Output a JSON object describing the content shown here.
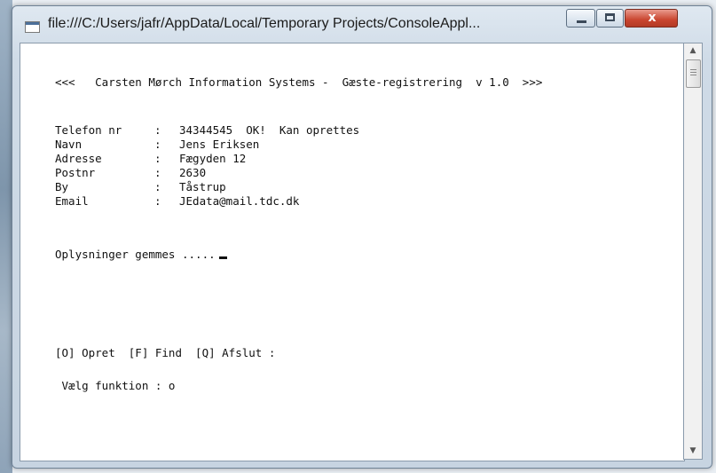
{
  "window": {
    "title": "file:///C:/Users/jafr/AppData/Local/Temporary Projects/ConsoleAppl...",
    "close_glyph": "x"
  },
  "console": {
    "header": "<<<   Carsten Mørch Information Systems -  Gæste-registrering  v 1.0  >>>",
    "fields": [
      {
        "label": "Telefon nr",
        "value": "34344545  OK!  Kan oprettes"
      },
      {
        "label": "Navn",
        "value": "Jens Eriksen"
      },
      {
        "label": "Adresse",
        "value": "Fægyden 12"
      },
      {
        "label": "Postnr",
        "value": "2630"
      },
      {
        "label": "By",
        "value": "Tåstrup"
      },
      {
        "label": "Email",
        "value": "JEdata@mail.tdc.dk"
      }
    ],
    "separator": ":",
    "saving_message": "Oplysninger gemmes .....",
    "menu": "[O] Opret  [F] Find  [Q] Afslut :",
    "prompt": " Vælg funktion : o"
  },
  "colors": {
    "console_background": "#ffffff",
    "console_text": "#111111",
    "close_button": "#c9452f"
  }
}
